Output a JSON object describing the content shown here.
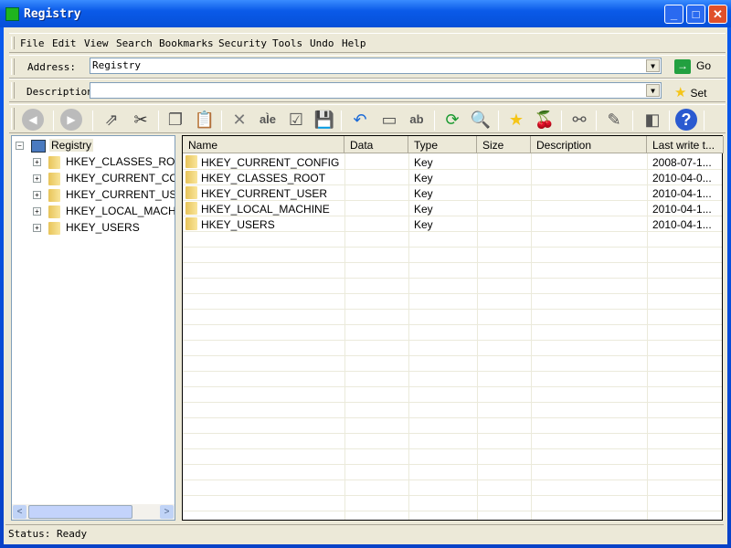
{
  "window": {
    "title": "Registry"
  },
  "menu": [
    "File",
    "Edit",
    "View",
    "Search",
    "Bookmarks",
    "Security",
    "Tools",
    "Undo",
    "Help"
  ],
  "address": {
    "label": "Address:",
    "value": "Registry",
    "go_label": "Go"
  },
  "description": {
    "label": "Description",
    "value": "",
    "set_label": "Set"
  },
  "toolbar": [
    {
      "name": "back-icon",
      "glyph": "◀"
    },
    {
      "name": "forward-icon",
      "glyph": "▶"
    },
    {
      "name": "export-icon",
      "glyph": "⇗"
    },
    {
      "name": "cut-icon",
      "glyph": "✂"
    },
    {
      "name": "copy-icon",
      "glyph": "❐"
    },
    {
      "name": "paste-icon",
      "glyph": "📋"
    },
    {
      "name": "delete-icon",
      "glyph": "✕"
    },
    {
      "name": "rename-icon",
      "glyph": "aÌe"
    },
    {
      "name": "edit-value-icon",
      "glyph": "☑"
    },
    {
      "name": "save-icon",
      "glyph": "💾"
    },
    {
      "name": "undo-icon",
      "glyph": "↶"
    },
    {
      "name": "new-key-icon",
      "glyph": "▭"
    },
    {
      "name": "new-value-icon",
      "glyph": "ab"
    },
    {
      "name": "refresh-icon",
      "glyph": "⟳"
    },
    {
      "name": "find-icon",
      "glyph": "🔍"
    },
    {
      "name": "bookmark-icon",
      "glyph": "★"
    },
    {
      "name": "cherries-icon",
      "glyph": "🍒"
    },
    {
      "name": "network-icon",
      "glyph": "⚯"
    },
    {
      "name": "connect-icon",
      "glyph": "✎"
    },
    {
      "name": "windows-icon",
      "glyph": "◧"
    },
    {
      "name": "help-icon",
      "glyph": "?"
    }
  ],
  "tree": {
    "root": "Registry",
    "children": [
      "HKEY_CLASSES_ROOT",
      "HKEY_CURRENT_CONFIG",
      "HKEY_CURRENT_USER",
      "HKEY_LOCAL_MACHINE",
      "HKEY_USERS"
    ]
  },
  "list": {
    "columns": [
      "Name",
      "Data",
      "Type",
      "Size",
      "Description",
      "Last write t..."
    ],
    "rows": [
      {
        "name": "HKEY_CURRENT_CONFIG",
        "data": "",
        "type": "Key",
        "size": "",
        "description": "",
        "last_write": "2008-07-1..."
      },
      {
        "name": "HKEY_CLASSES_ROOT",
        "data": "",
        "type": "Key",
        "size": "",
        "description": "",
        "last_write": "2010-04-0..."
      },
      {
        "name": "HKEY_CURRENT_USER",
        "data": "",
        "type": "Key",
        "size": "",
        "description": "",
        "last_write": "2010-04-1..."
      },
      {
        "name": "HKEY_LOCAL_MACHINE",
        "data": "",
        "type": "Key",
        "size": "",
        "description": "",
        "last_write": "2010-04-1..."
      },
      {
        "name": "HKEY_USERS",
        "data": "",
        "type": "Key",
        "size": "",
        "description": "",
        "last_write": "2010-04-1..."
      }
    ]
  },
  "status": "Status: Ready",
  "colors": {
    "titlebar": "#0a5ae8",
    "face": "#ece9d8",
    "go": "#22a040",
    "star": "#f5c518"
  }
}
